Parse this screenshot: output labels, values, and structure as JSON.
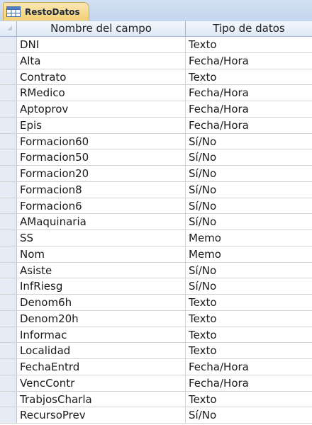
{
  "tab": {
    "label": "RestoDatos",
    "icon": "table-icon"
  },
  "columns": {
    "name": "Nombre del campo",
    "type": "Tipo de datos"
  },
  "fields": [
    {
      "name": "DNI",
      "type": "Texto"
    },
    {
      "name": "Alta",
      "type": "Fecha/Hora"
    },
    {
      "name": "Contrato",
      "type": "Texto"
    },
    {
      "name": "RMedico",
      "type": "Fecha/Hora"
    },
    {
      "name": "Aptoprov",
      "type": "Fecha/Hora"
    },
    {
      "name": "Epis",
      "type": "Fecha/Hora"
    },
    {
      "name": "Formacion60",
      "type": "Sí/No"
    },
    {
      "name": "Formacion50",
      "type": "Sí/No"
    },
    {
      "name": "Formacion20",
      "type": "Sí/No"
    },
    {
      "name": "Formacion8",
      "type": "Sí/No"
    },
    {
      "name": "Formacion6",
      "type": "Sí/No"
    },
    {
      "name": "AMaquinaria",
      "type": "Sí/No"
    },
    {
      "name": "SS",
      "type": "Memo"
    },
    {
      "name": "Nom",
      "type": "Memo"
    },
    {
      "name": "Asiste",
      "type": "Sí/No"
    },
    {
      "name": "InfRiesg",
      "type": "Sí/No"
    },
    {
      "name": "Denom6h",
      "type": "Texto"
    },
    {
      "name": "Denom20h",
      "type": "Texto"
    },
    {
      "name": "Informac",
      "type": "Texto"
    },
    {
      "name": "Localidad",
      "type": "Texto"
    },
    {
      "name": "FechaEntrd",
      "type": "Fecha/Hora"
    },
    {
      "name": "VencContr",
      "type": "Fecha/Hora"
    },
    {
      "name": "TrabjosCharla",
      "type": "Texto"
    },
    {
      "name": "RecursoPrev",
      "type": "Sí/No"
    }
  ]
}
